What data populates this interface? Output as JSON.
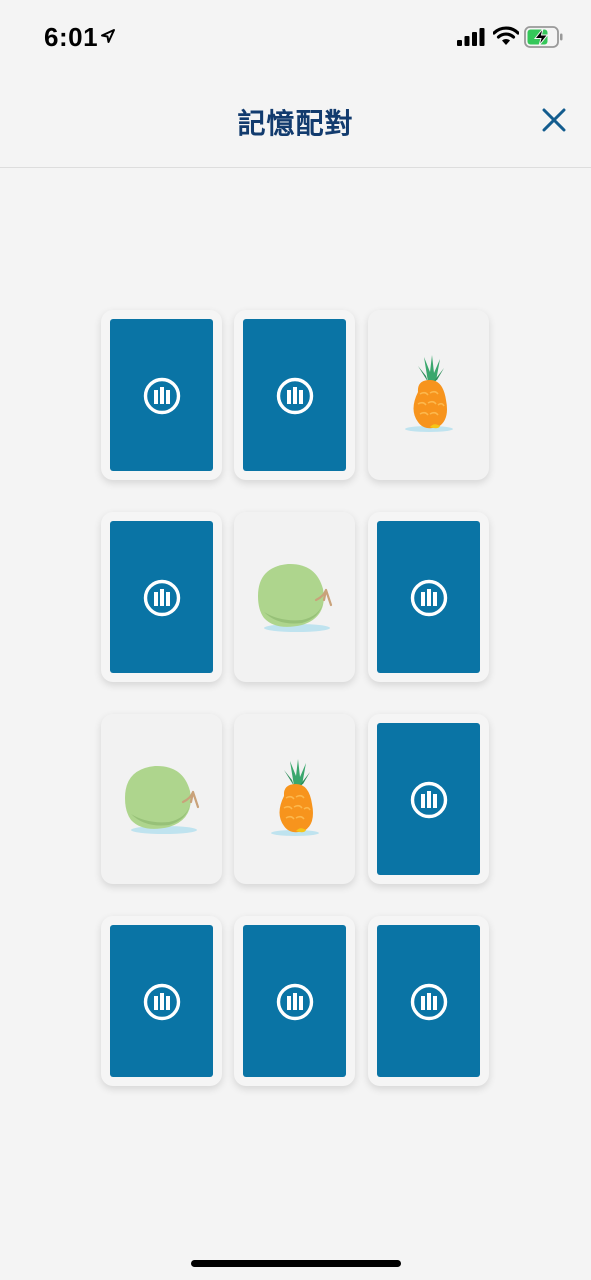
{
  "status_bar": {
    "time": "6:01"
  },
  "header": {
    "title": "記憶配對",
    "close_icon": "close-icon"
  },
  "board": {
    "rows": 4,
    "columns": 3,
    "cards": [
      {
        "state": "face-down"
      },
      {
        "state": "face-down"
      },
      {
        "state": "face-up",
        "item": "pineapple"
      },
      {
        "state": "face-down"
      },
      {
        "state": "face-up",
        "item": "coconut"
      },
      {
        "state": "face-down"
      },
      {
        "state": "face-up",
        "item": "coconut"
      },
      {
        "state": "face-up",
        "item": "pineapple"
      },
      {
        "state": "face-down"
      },
      {
        "state": "face-down"
      },
      {
        "state": "face-down"
      },
      {
        "state": "face-down"
      }
    ]
  },
  "colors": {
    "card_back": "#0a74a5",
    "title": "#123b6e",
    "background": "#f4f4f4"
  }
}
